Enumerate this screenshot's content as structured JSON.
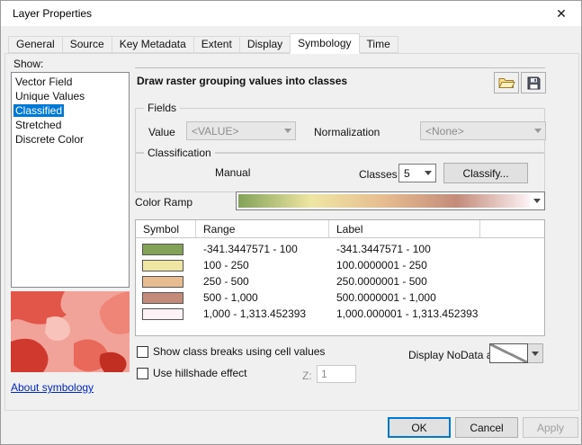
{
  "window": {
    "title": "Layer Properties",
    "close_glyph": "✕"
  },
  "tabs": [
    "General",
    "Source",
    "Key Metadata",
    "Extent",
    "Display",
    "Symbology",
    "Time"
  ],
  "active_tab": "Symbology",
  "show_panel": {
    "label": "Show:",
    "items": [
      "Vector Field",
      "Unique Values",
      "Classified",
      "Stretched",
      "Discrete Color"
    ],
    "selected_item": "Classified",
    "about_link": "About symbology"
  },
  "main_panel": {
    "header": "Draw raster grouping values into classes",
    "fields": {
      "legend": "Fields",
      "value_label": "Value",
      "value_combo": "<VALUE>",
      "normalization_label": "Normalization",
      "normalization_combo": "<None>"
    },
    "classification": {
      "legend": "Classification",
      "method": "Manual",
      "classes_label": "Classes",
      "classes_value": "5",
      "classify_button": "Classify..."
    },
    "color_ramp": {
      "label": "Color Ramp",
      "colors": [
        "#82a258",
        "#efe6a3",
        "#e6bc90",
        "#c48b7a",
        "#fdf2f6"
      ]
    },
    "class_table": {
      "headers": [
        "Symbol",
        "Range",
        "Label"
      ],
      "rows": [
        {
          "color": "#82a258",
          "range": "-341.3447571 - 100",
          "label": "-341.3447571 - 100"
        },
        {
          "color": "#efe6a3",
          "range": "100 - 250",
          "label": "100.0000001 - 250"
        },
        {
          "color": "#e6bc90",
          "range": "250 - 500",
          "label": "250.0000001 - 500"
        },
        {
          "color": "#c48b7a",
          "range": "500 - 1,000",
          "label": "500.0000001 - 1,000"
        },
        {
          "color": "#fdf2f6",
          "range": "1,000 - 1,313.452393",
          "label": "1,000.000001 - 1,313.452393"
        }
      ]
    },
    "options": {
      "show_class_breaks": {
        "label": "Show class breaks using cell values",
        "checked": false
      },
      "hillshade": {
        "label": "Use hillshade effect",
        "checked": false
      },
      "z_label": "Z:",
      "z_value": "1",
      "nodata_label": "Display NoData as"
    }
  },
  "footer": {
    "ok": "OK",
    "cancel": "Cancel",
    "apply": "Apply"
  }
}
